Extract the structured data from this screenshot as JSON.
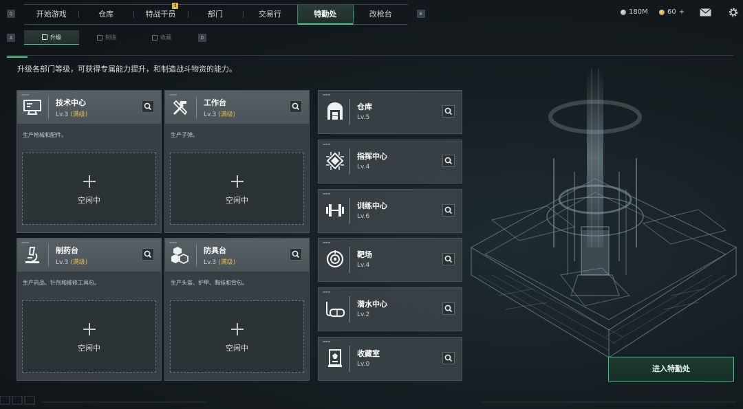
{
  "keys": {
    "nav_prev": "Q",
    "nav_next": "E",
    "sub_prev": "A",
    "sub_next": "D"
  },
  "nav": {
    "tabs": [
      {
        "label": "开始游戏"
      },
      {
        "label": "仓库"
      },
      {
        "label": "特战干员",
        "badge": "!"
      },
      {
        "label": "部门"
      },
      {
        "label": "交易行"
      },
      {
        "label": "特勤处",
        "active": true
      },
      {
        "label": "改枪台"
      }
    ]
  },
  "resources": {
    "money": "180M",
    "currency": "60",
    "currency_plus": "+"
  },
  "subnav": {
    "tabs": [
      {
        "label": "升级",
        "active": true
      },
      {
        "label": "制造"
      },
      {
        "label": "收藏"
      }
    ]
  },
  "description": "升级各部门等级，可获得专属能力提升，和制造战斗物资的能力。",
  "big_cards": [
    {
      "title": "技术中心",
      "level": "Lv.3",
      "max_tag": "(满级)",
      "note": "生产枪械和配件。",
      "slot": "空闲中",
      "icon": "computer-icon"
    },
    {
      "title": "工作台",
      "level": "Lv.3",
      "max_tag": "(满级)",
      "note": "生产子弹。",
      "slot": "空闲中",
      "icon": "tools-icon"
    },
    {
      "title": "制药台",
      "level": "Lv.3",
      "max_tag": "(满级)",
      "note": "生产药品、针剂和维修工具包。",
      "slot": "空闲中",
      "icon": "microscope-icon"
    },
    {
      "title": "防具台",
      "level": "Lv.3",
      "max_tag": "(满级)",
      "note": "生产头盔、护甲、胸挂和背包。",
      "slot": "空闲中",
      "icon": "cubes-icon"
    }
  ],
  "small_cards": [
    {
      "title": "仓库",
      "level": "Lv.5",
      "icon": "warehouse-icon"
    },
    {
      "title": "指挥中心",
      "level": "Lv.4",
      "icon": "chip-icon"
    },
    {
      "title": "训练中心",
      "level": "Lv.6",
      "icon": "dumbbell-icon"
    },
    {
      "title": "靶场",
      "level": "Lv.4",
      "icon": "target-icon"
    },
    {
      "title": "潜水中心",
      "level": "Lv.2",
      "icon": "diving-mask-icon"
    },
    {
      "title": "收藏室",
      "level": "Lv.0",
      "icon": "display-case-icon"
    }
  ],
  "enter_button": "进入特勤处",
  "colors": {
    "accent": "#3ecf8e",
    "max_level": "#e0b94a",
    "panel": "#3a4247"
  }
}
